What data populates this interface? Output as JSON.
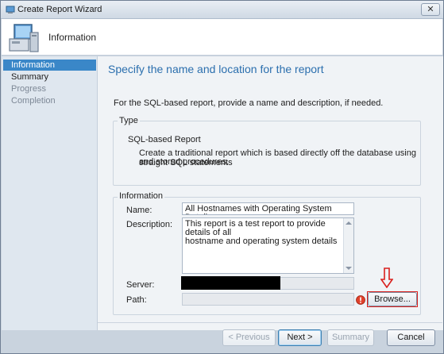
{
  "window": {
    "title": "Create Report Wizard",
    "close_glyph": "✕"
  },
  "header": {
    "title": "Information",
    "icon": "computer-icon"
  },
  "sidebar": {
    "items": [
      {
        "label": "Information",
        "state": "active"
      },
      {
        "label": "Summary",
        "state": "normal"
      },
      {
        "label": "Progress",
        "state": "disabled"
      },
      {
        "label": "Completion",
        "state": "disabled"
      }
    ]
  },
  "page": {
    "heading": "Specify the name and location for the report",
    "instruction": "For the SQL-based report, provide a name and description, if needed."
  },
  "type_group": {
    "legend": "Type",
    "option_title": "SQL-based Report",
    "option_desc_line1": "Create a traditional report which is based directly off the database using straight SQL statements",
    "option_desc_line2": "and stored procedures."
  },
  "info_group": {
    "legend": "Information",
    "name_label": "Name:",
    "name_value": "All Hostnames with Operating System Details",
    "description_label": "Description:",
    "description_line1": "This report is a test report to provide details of all",
    "description_line2": "hostname and operating system details",
    "server_label": "Server:",
    "server_value": "",
    "path_label": "Path:",
    "path_value": "",
    "browse_label": "Browse...",
    "warning_icon": "error-icon"
  },
  "footer": {
    "previous_label": "< Previous",
    "next_label": "Next >",
    "summary_label": "Summary",
    "cancel_label": "Cancel"
  },
  "colors": {
    "accent": "#3a87c8",
    "heading": "#2b6fae",
    "annotation": "#d9201d"
  }
}
